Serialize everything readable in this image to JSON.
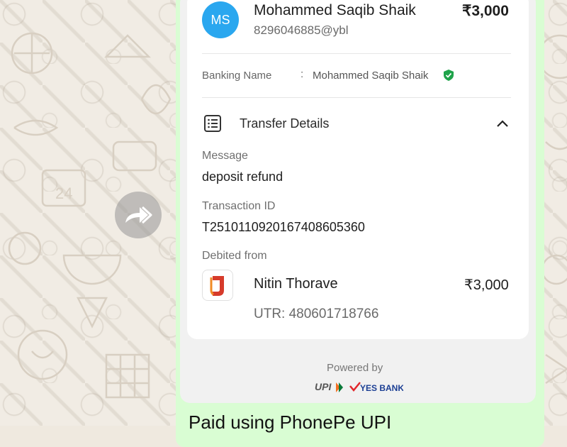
{
  "payee": {
    "initials": "MS",
    "name": "Mohammed Saqib Shaik",
    "vpa": "8296046885@ybl",
    "amount": "₹3,000"
  },
  "banking": {
    "label": "Banking Name",
    "colon": ":",
    "value": "Mohammed Saqib Shaik",
    "verified_icon": "verified-shield-icon"
  },
  "transfer": {
    "title": "Transfer Details",
    "icon": "list-icon",
    "toggle_icon": "chevron-up-icon",
    "message_label": "Message",
    "message_value": "deposit refund",
    "txn_label": "Transaction ID",
    "txn_value": "T2510110920167408605360",
    "debited_label": "Debited from",
    "debited_name": "Nitin Thorave",
    "debited_amount": "₹3,000",
    "utr": "UTR: 480601718766"
  },
  "footer": {
    "powered_by": "Powered by",
    "bottom_text": "Paid using PhonePe UPI"
  },
  "colors": {
    "bubble": "#d9fdd3",
    "avatar": "#2aa7ef",
    "verified": "#1fa34a"
  }
}
